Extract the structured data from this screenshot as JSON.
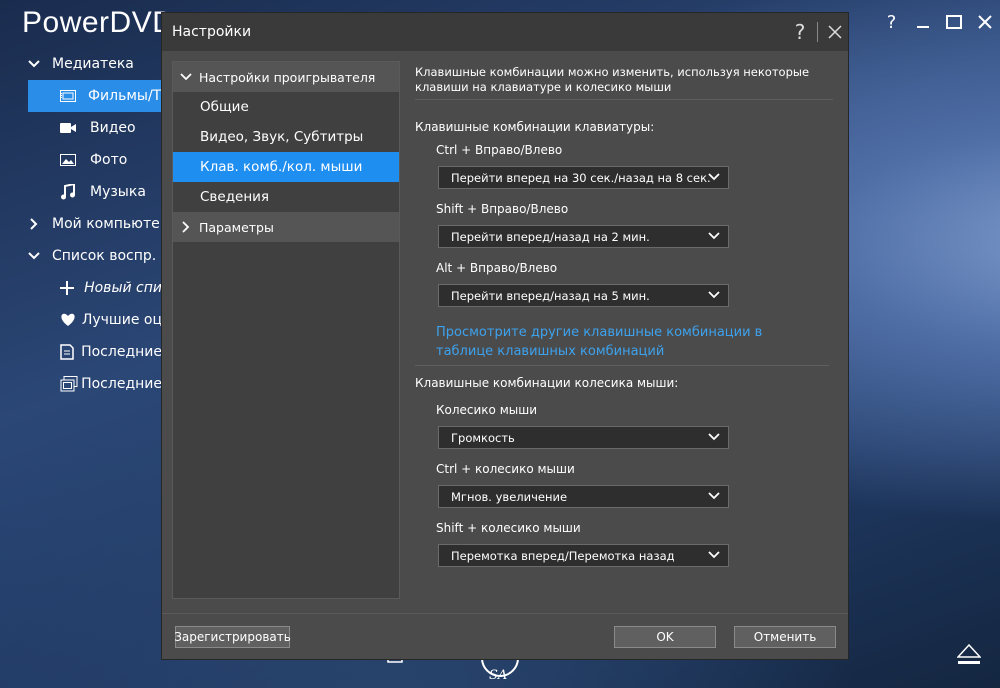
{
  "app": {
    "title": "PowerDVD",
    "window_controls": [
      "?",
      "minimize",
      "maximize",
      "close"
    ]
  },
  "sidebar": {
    "items": [
      {
        "label": "Медиатека",
        "type": "group",
        "expanded": true
      },
      {
        "label": "Фильмы/Т",
        "icon": "film-icon",
        "active": true
      },
      {
        "label": "Видео",
        "icon": "video-camera-icon"
      },
      {
        "label": "Фото",
        "icon": "photo-icon"
      },
      {
        "label": "Музыка",
        "icon": "music-note-icon"
      },
      {
        "label": "Мой компьюте",
        "type": "group",
        "expanded": false
      },
      {
        "label": "Список воспр.",
        "type": "group",
        "expanded": true
      },
      {
        "label": "Новый спи",
        "icon": "plus-icon",
        "italic": true
      },
      {
        "label": "Лучшие оц",
        "icon": "heart-icon"
      },
      {
        "label": "Последние",
        "icon": "recent-doc-icon"
      },
      {
        "label": "Последние",
        "icon": "recent-media-icon"
      }
    ]
  },
  "player": {
    "sa_label": "SA"
  },
  "dialog": {
    "title": "Настройки",
    "help_label": "?",
    "nav": {
      "group1": "Настройки проигрывателя",
      "items": [
        "Общие",
        "Видео, Звук, Субтитры",
        "Клав. комб./кол. мыши",
        "Сведения"
      ],
      "active_index": 2,
      "group2": "Параметры"
    },
    "content": {
      "description": "Клавишные комбинации можно изменить, используя некоторые клавиши на клавиатуре и колесико мыши",
      "keyboard_section": "Клавишные комбинации клавиатуры:",
      "keyboard": [
        {
          "label": "Ctrl + Вправо/Влево",
          "value": "Перейти вперед на 30 сек./назад на 8 сек."
        },
        {
          "label": "Shift + Вправо/Влево",
          "value": "Перейти вперед/назад на 2 мин."
        },
        {
          "label": "Alt + Вправо/Влево",
          "value": "Перейти вперед/назад на 5 мин."
        }
      ],
      "link": "Просмотрите другие клавишные комбинации в таблице клавишных комбинаций",
      "mouse_section": "Клавишные комбинации колесика мыши:",
      "mouse": [
        {
          "label": "Колесико мыши",
          "value": "Громкость"
        },
        {
          "label": "Ctrl + колесико мыши",
          "value": "Мгнов. увеличение"
        },
        {
          "label": "Shift + колесико мыши",
          "value": "Перемотка вперед/Перемотка назад"
        }
      ]
    },
    "footer": {
      "register": "Зарегистрировать",
      "ok": "OK",
      "cancel": "Отменить"
    }
  },
  "colors": {
    "accent": "#1f8ef1",
    "link": "#3da2ee",
    "dialog_bg": "#4b4b4b"
  }
}
